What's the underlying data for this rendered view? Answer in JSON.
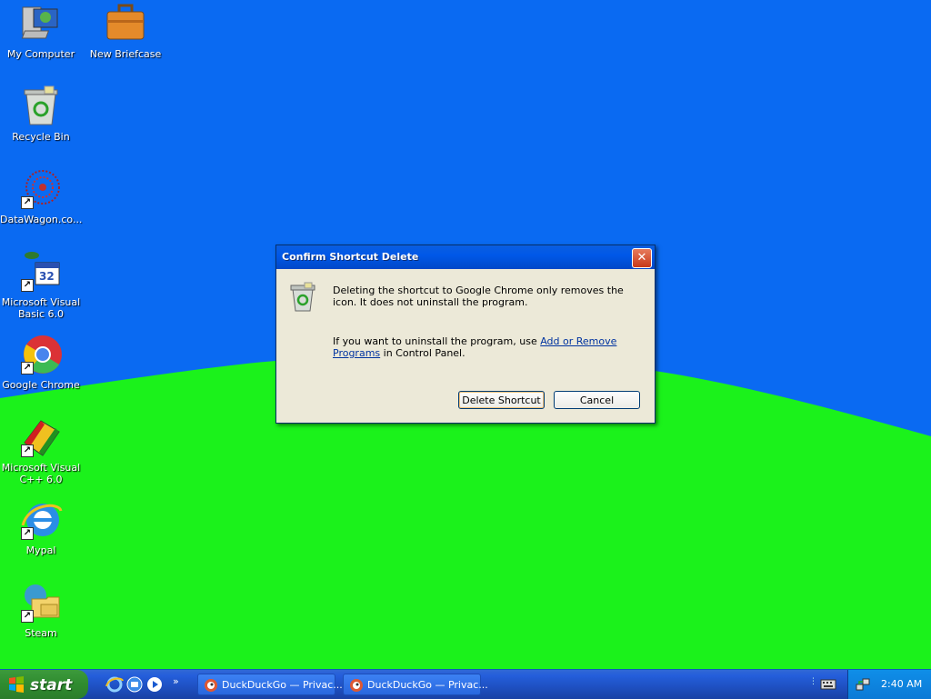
{
  "desktop_icons": [
    {
      "label": "My Computer"
    },
    {
      "label": "New Briefcase"
    },
    {
      "label": "Recycle Bin"
    },
    {
      "label": "DataWagon.co..."
    },
    {
      "label": "Microsoft Visual\nBasic 6.0"
    },
    {
      "label": "Google Chrome"
    },
    {
      "label": "Microsoft Visual\nC++ 6.0"
    },
    {
      "label": "Mypal"
    },
    {
      "label": "Steam"
    }
  ],
  "dialog": {
    "title": "Confirm Shortcut Delete",
    "message": "Deleting the shortcut to Google Chrome only removes the icon. It does not uninstall the program.",
    "uninstall_prefix": "If you want to uninstall the program, use ",
    "uninstall_link": "Add or Remove Programs",
    "uninstall_suffix": " in Control Panel.",
    "delete_button": "Delete Shortcut",
    "cancel_button": "Cancel",
    "close_glyph": "✕"
  },
  "taskbar": {
    "start_label": "start",
    "tasks": [
      {
        "label": "DuckDuckGo — Privac..."
      },
      {
        "label": "DuckDuckGo — Privac..."
      }
    ],
    "quicklaunch_more": "»",
    "clock": "2:40 AM"
  },
  "colors": {
    "sky": "#0a6af2",
    "hill": "#1bf21b",
    "taskbar": "#245edb",
    "start": "#2f8b2f"
  }
}
